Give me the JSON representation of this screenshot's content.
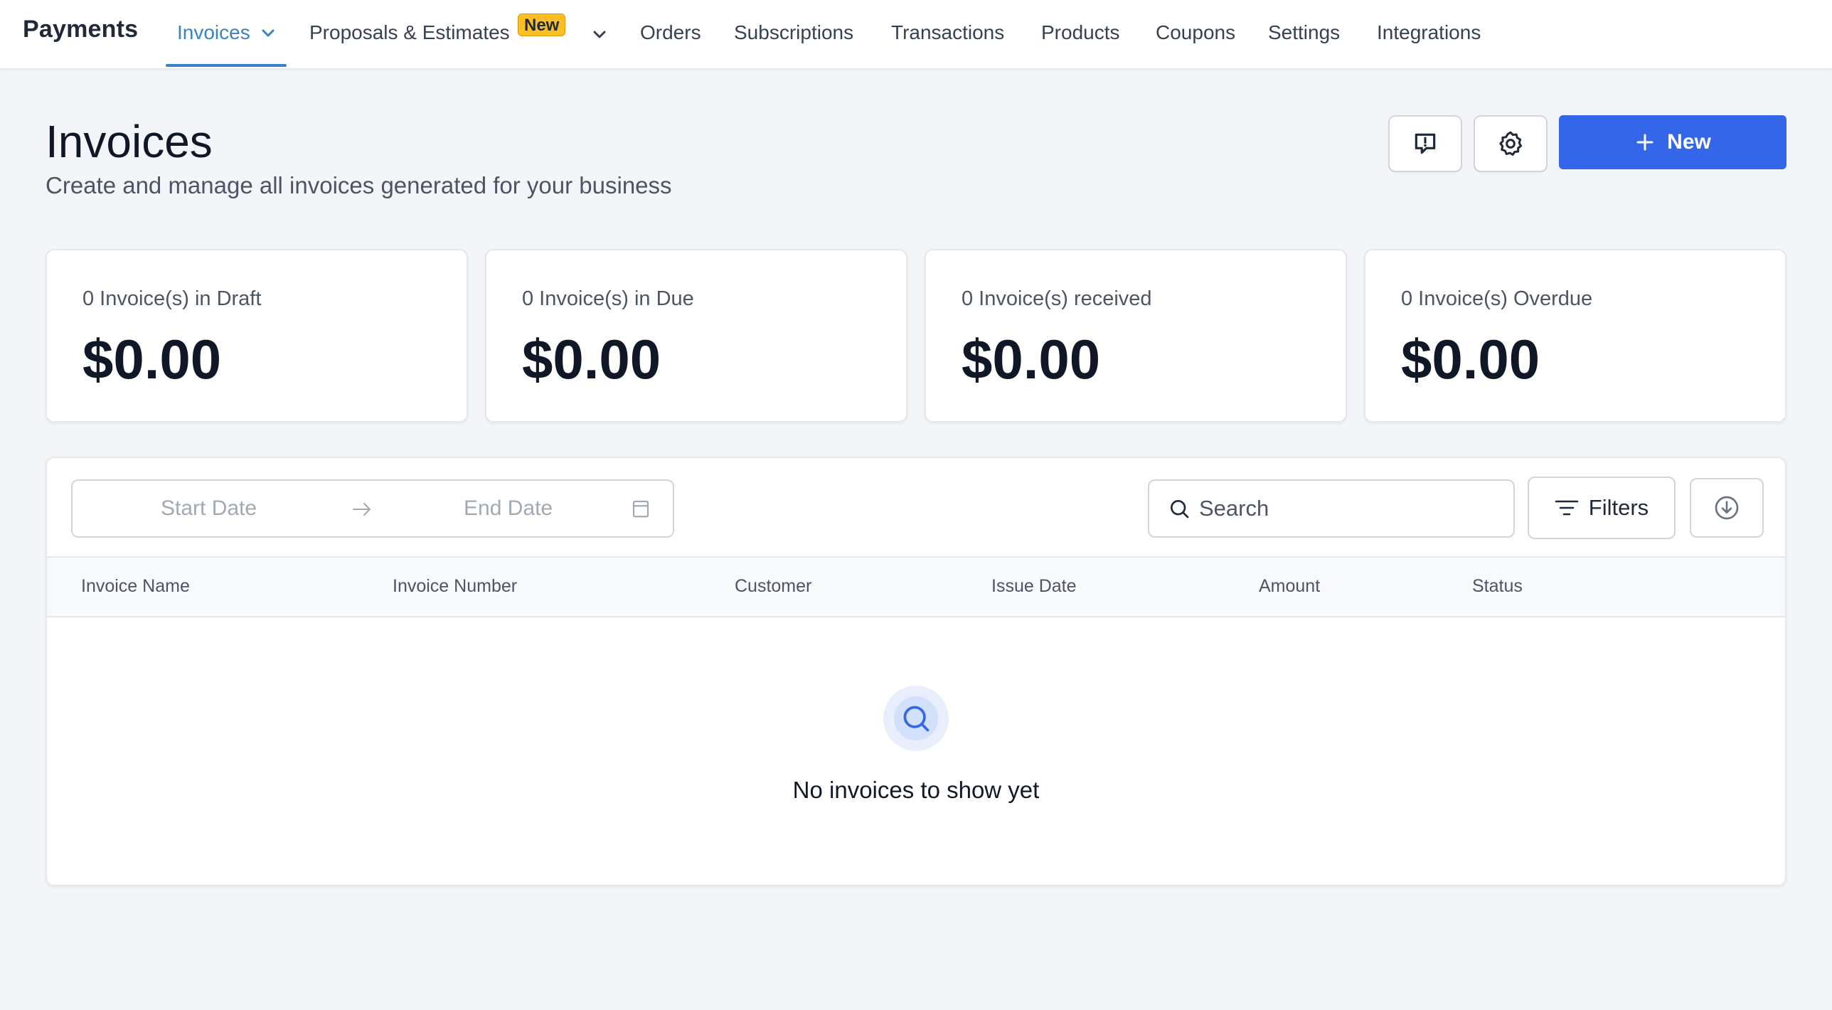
{
  "nav": {
    "brand": "Payments",
    "items": [
      {
        "label": "Invoices",
        "active": true,
        "dropdown": true
      },
      {
        "label": "Proposals & Estimates",
        "badge": "New",
        "dropdown": true
      },
      {
        "label": "Orders"
      },
      {
        "label": "Subscriptions"
      },
      {
        "label": "Transactions"
      },
      {
        "label": "Products"
      },
      {
        "label": "Coupons"
      },
      {
        "label": "Settings"
      },
      {
        "label": "Integrations"
      }
    ]
  },
  "header": {
    "title": "Invoices",
    "subtitle": "Create and manage all invoices generated for your business",
    "new_button": "New",
    "icons": [
      "feedback-icon",
      "gear-icon",
      "plus-icon"
    ]
  },
  "stats": [
    {
      "label": "0 Invoice(s) in Draft",
      "value": "$0.00"
    },
    {
      "label": "0 Invoice(s) in Due",
      "value": "$0.00"
    },
    {
      "label": "0 Invoice(s) received",
      "value": "$0.00"
    },
    {
      "label": "0 Invoice(s) Overdue",
      "value": "$0.00"
    }
  ],
  "filters": {
    "start_date_placeholder": "Start Date",
    "end_date_placeholder": "End Date",
    "search_placeholder": "Search",
    "filters_label": "Filters"
  },
  "table": {
    "columns": [
      "Invoice Name",
      "Invoice Number",
      "Customer",
      "Issue Date",
      "Amount",
      "Status"
    ],
    "rows": [],
    "empty_message": "No invoices to show yet"
  },
  "colors": {
    "accent": "#3366e8",
    "nav_active": "#3b82c4",
    "badge": "#fbbf24",
    "background": "#f3f5f8"
  }
}
